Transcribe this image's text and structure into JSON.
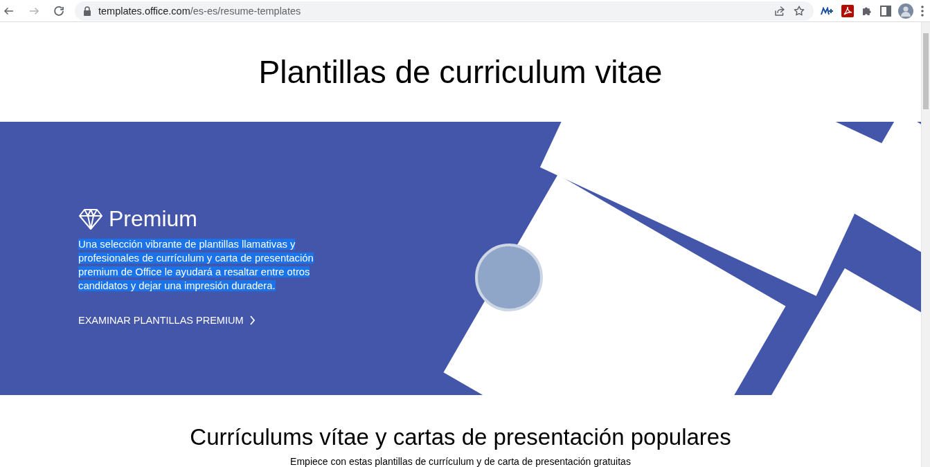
{
  "browser": {
    "url_host": "templates.office.com",
    "url_path": "/es-es/resume-templates",
    "forward_disabled": true
  },
  "page": {
    "title": "Plantillas de curriculum vitae",
    "hero": {
      "heading": "Premium",
      "description": "Una selección vibrante de plantillas llamativas y profesionales de currículum y carta de presentación premium de Office le ayudará a resaltar entre otros candidatos y dejar una impresión duradera.",
      "description_selected": true,
      "link": "EXAMINAR PLANTILLAS PREMIUM"
    },
    "section_title": "Currículums vítae y cartas de presentación populares",
    "section_subtitle": "Empiece con estas plantillas de currículum y de carta de presentación gratuitas"
  }
}
